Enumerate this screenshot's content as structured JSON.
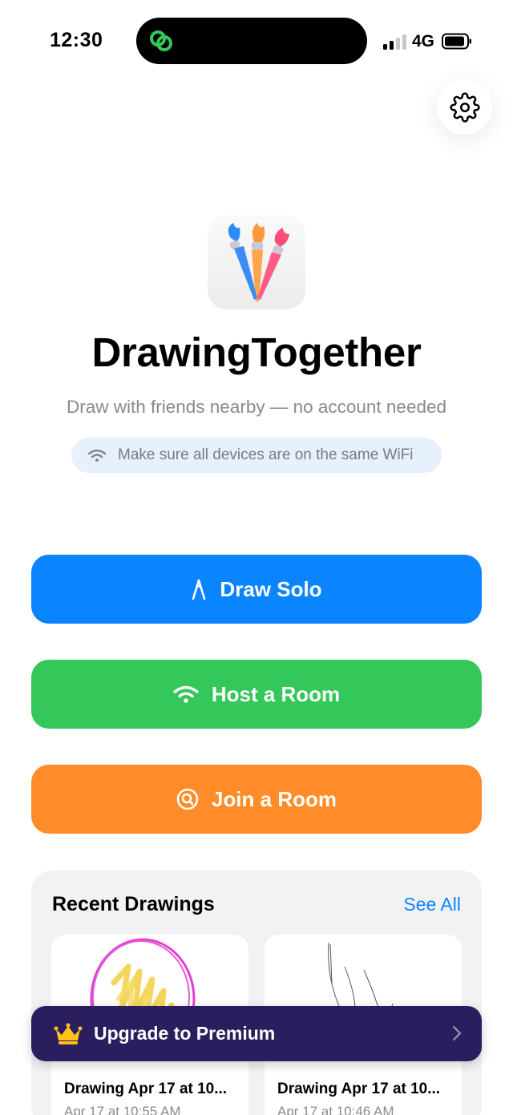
{
  "status_bar": {
    "time": "12:30",
    "network": "4G",
    "icons": [
      "link-icon",
      "signal-icon",
      "battery-icon"
    ]
  },
  "settings": {
    "icon": "gear-icon"
  },
  "hero": {
    "app_name": "DrawingTogether",
    "subtitle": "Draw with friends nearby — no account needed",
    "wifi_note": "Make sure all devices are on the same WiFi",
    "icon": "paintbrushes-icon"
  },
  "actions": {
    "draw_solo": {
      "label": "Draw Solo",
      "icon": "pencil-icon",
      "color": "#0a84ff"
    },
    "host_room": {
      "label": "Host a Room",
      "icon": "wifi-icon",
      "color": "#34c759"
    },
    "join_room": {
      "label": "Join a Room",
      "icon": "search-icon",
      "color": "#ff8c28"
    }
  },
  "recent": {
    "title": "Recent Drawings",
    "see_all": "See All",
    "items": [
      {
        "name": "Drawing Apr 17 at 10...",
        "date": "Apr 17 at 10:55 AM"
      },
      {
        "name": "Drawing Apr 17 at 10...",
        "date": "Apr 17 at 10:46 AM"
      }
    ]
  },
  "premium": {
    "label": "Upgrade to Premium",
    "icon": "crown-icon",
    "color": "#2a1e5e"
  }
}
